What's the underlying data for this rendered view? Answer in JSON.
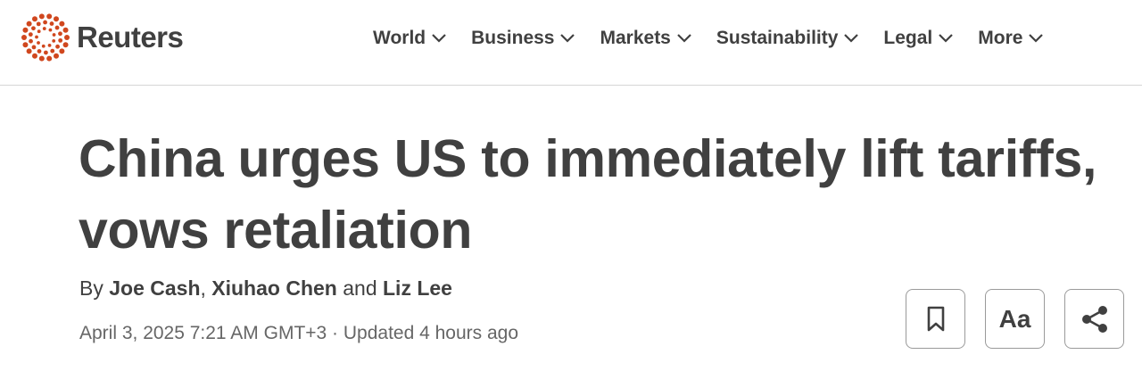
{
  "header": {
    "logo_text": "Reuters",
    "brand_color": "#d0471e",
    "nav": [
      {
        "label": "World"
      },
      {
        "label": "Business"
      },
      {
        "label": "Markets"
      },
      {
        "label": "Sustainability"
      },
      {
        "label": "Legal"
      },
      {
        "label": "More"
      }
    ]
  },
  "article": {
    "headline_line1": "China urges US to immediately lift tariffs,",
    "headline_line2": "vows retaliation",
    "byline": {
      "prefix": "By",
      "author1": "Joe Cash",
      "sep1": ",",
      "author2": "Xiuhao Chen",
      "sep2": "and",
      "author3": "Liz Lee"
    },
    "dateline": "April 3, 2025 7:21 AM GMT+3 · Updated 4 hours ago"
  },
  "tools": {
    "bookmark_icon": "bookmark-icon",
    "font_label": "Aa",
    "share_icon": "share-icon"
  }
}
